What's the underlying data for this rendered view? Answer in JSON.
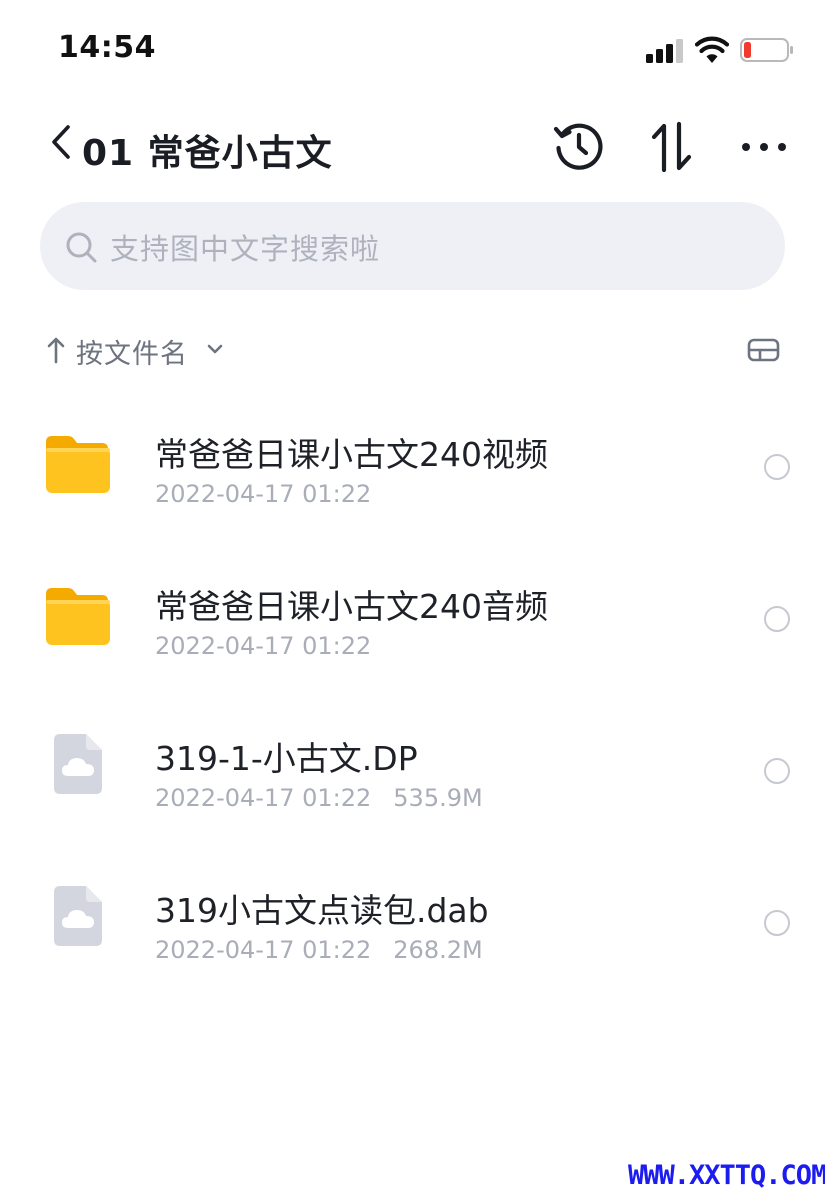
{
  "status_bar": {
    "time": "14:54"
  },
  "header": {
    "title": "01 常爸小古文"
  },
  "search": {
    "placeholder": "支持图中文字搜索啦"
  },
  "sort": {
    "label": "按文件名"
  },
  "files": [
    {
      "name": "常爸爸日课小古文240视频",
      "date": "2022-04-17 01:22",
      "size": "",
      "type": "folder"
    },
    {
      "name": "常爸爸日课小古文240音频",
      "date": "2022-04-17 01:22",
      "size": "",
      "type": "folder"
    },
    {
      "name": "319-1-小古文.DP",
      "date": "2022-04-17 01:22",
      "size": "535.9M",
      "type": "cloud-file"
    },
    {
      "name": "319小古文点读包.dab",
      "date": "2022-04-17 01:22",
      "size": "268.2M",
      "type": "cloud-file"
    }
  ],
  "watermark": "WWW.XXTTQ.COM",
  "colors": {
    "folder": "#ffc31f",
    "folder_dark": "#f5aa00",
    "search_bg": "#eef0f5",
    "meta_text": "#a9adb7",
    "battery_low": "#f23b2f"
  },
  "icons": {
    "back": "chevron-left-icon",
    "history": "history-icon",
    "sort": "sort-arrows-icon",
    "more": "more-dots-icon",
    "search": "search-icon",
    "view": "view-toggle-icon"
  }
}
